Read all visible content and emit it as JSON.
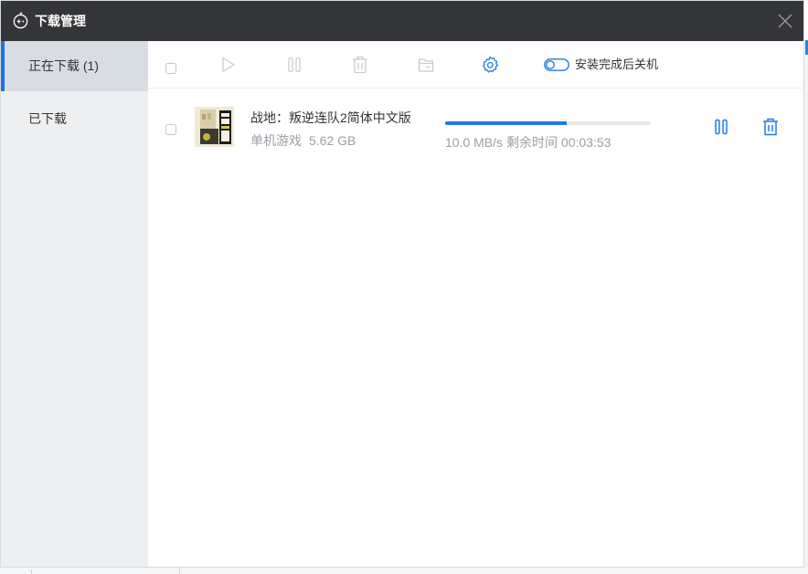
{
  "window": {
    "title": "下载管理",
    "accent_color": "#1e7be8",
    "titlebar_color": "#343538"
  },
  "sidebar": {
    "items": [
      {
        "label": "正在下载 (1)",
        "active": true
      },
      {
        "label": "已下载",
        "active": false
      }
    ]
  },
  "toolbar": {
    "buttons": [
      {
        "icon": "checkbox-icon",
        "label": ""
      },
      {
        "icon": "play-icon",
        "label": ""
      },
      {
        "icon": "pause-icon",
        "label": ""
      },
      {
        "icon": "trash-icon",
        "label": ""
      },
      {
        "icon": "folder-icon",
        "label": ""
      },
      {
        "icon": "gear-icon",
        "label": ""
      }
    ],
    "shutdown_toggle": {
      "label": "安装完成后关机",
      "on": false
    }
  },
  "downloads": [
    {
      "name": "战地：叛逆连队2简体中文版",
      "category": "单机游戏",
      "size": "5.62 GB",
      "speed": "10.0 MB/s",
      "remaining": "剩余时间 00:03:53",
      "progress": 0.59
    }
  ]
}
